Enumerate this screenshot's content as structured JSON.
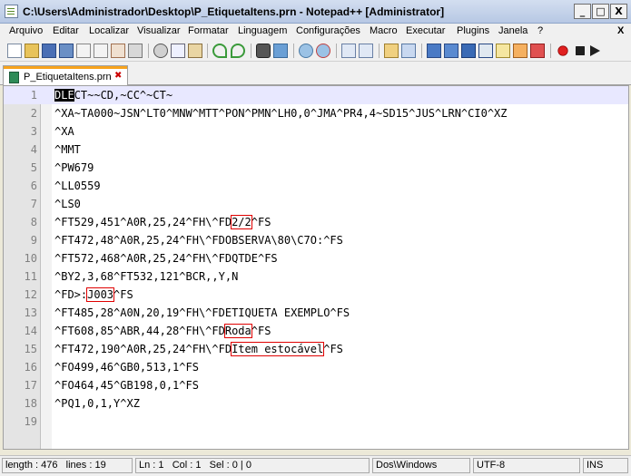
{
  "window": {
    "title": "C:\\Users\\Administrador\\Desktop\\P_EtiquetaItens.prn - Notepad++ [Administrator]",
    "minimize_label": "_",
    "maximize_label": "□",
    "close_label": "X"
  },
  "menu": {
    "items": [
      "Arquivo",
      "Editar",
      "Localizar",
      "Visualizar",
      "Formatar",
      "Linguagem",
      "Configurações",
      "Macro",
      "Executar",
      "Plugins",
      "Janela",
      "?"
    ],
    "close_label": "X"
  },
  "toolbar": {
    "icons": [
      "new-file-icon",
      "open-file-icon",
      "save-icon",
      "save-all-icon",
      "close-icon",
      "close-all-icon",
      "print-icon",
      "cut-icon",
      "copy-icon",
      "paste-icon",
      "undo-icon",
      "redo-icon",
      "find-icon",
      "replace-icon",
      "zoom-in-icon",
      "zoom-out-icon",
      "sync-v-icon",
      "sync-h-icon",
      "word-wrap-icon",
      "show-all-chars-icon",
      "indent-guide-icon",
      "doc-map-icon",
      "function-list-icon",
      "folder-workspace-icon",
      "monitor-icon",
      "record-macro-icon",
      "stop-macro-icon",
      "play-macro-icon"
    ]
  },
  "tab": {
    "label": "P_EtiquetaItens.prn",
    "close_label": "✖"
  },
  "editor": {
    "lines": [
      {
        "num": "1",
        "segments": [
          {
            "text": "DLE",
            "style": "dle"
          },
          {
            "text": "CT~~CD,~CC^~CT~"
          }
        ]
      },
      {
        "num": "2",
        "segments": [
          {
            "text": "^XA~TA000~JSN^LT0^MNW^MTT^PON^PMN^LH0,0^JMA^PR4,4~SD15^JUS^LRN^CI0^XZ"
          }
        ]
      },
      {
        "num": "3",
        "segments": [
          {
            "text": "^XA"
          }
        ]
      },
      {
        "num": "4",
        "segments": [
          {
            "text": "^MMT"
          }
        ]
      },
      {
        "num": "5",
        "segments": [
          {
            "text": "^PW679"
          }
        ]
      },
      {
        "num": "6",
        "segments": [
          {
            "text": "^LL0559"
          }
        ]
      },
      {
        "num": "7",
        "segments": [
          {
            "text": "^LS0"
          }
        ]
      },
      {
        "num": "8",
        "segments": [
          {
            "text": "^FT529,451^A0R,25,24^FH\\^FD"
          },
          {
            "text": "2/2",
            "style": "hl"
          },
          {
            "text": "^FS"
          }
        ]
      },
      {
        "num": "9",
        "segments": [
          {
            "text": "^FT472,48^A0R,25,24^FH\\^FDOBSERVA\\80\\C7O:^FS"
          }
        ]
      },
      {
        "num": "10",
        "segments": [
          {
            "text": "^FT572,468^A0R,25,24^FH\\^FDQTDE^FS"
          }
        ]
      },
      {
        "num": "11",
        "segments": [
          {
            "text": "^BY2,3,68^FT532,121^BCR,,Y,N"
          }
        ]
      },
      {
        "num": "12",
        "segments": [
          {
            "text": "^FD>:"
          },
          {
            "text": "J003",
            "style": "hl"
          },
          {
            "text": "^FS"
          }
        ]
      },
      {
        "num": "13",
        "segments": [
          {
            "text": "^FT485,28^A0N,20,19^FH\\^FDETIQUETA EXEMPLO^FS"
          }
        ]
      },
      {
        "num": "14",
        "segments": [
          {
            "text": "^FT608,85^ABR,44,28^FH\\^FD"
          },
          {
            "text": "Roda",
            "style": "hl"
          },
          {
            "text": "^FS"
          }
        ]
      },
      {
        "num": "15",
        "segments": [
          {
            "text": "^FT472,190^A0R,25,24^FH\\^FD"
          },
          {
            "text": "Item estocável",
            "style": "hl"
          },
          {
            "text": "^FS"
          }
        ]
      },
      {
        "num": "16",
        "segments": [
          {
            "text": "^FO499,46^GB0,513,1^FS"
          }
        ]
      },
      {
        "num": "17",
        "segments": [
          {
            "text": "^FO464,45^GB198,0,1^FS"
          }
        ]
      },
      {
        "num": "18",
        "segments": [
          {
            "text": "^PQ1,0,1,Y^XZ"
          }
        ]
      },
      {
        "num": "19",
        "segments": []
      }
    ]
  },
  "status": {
    "length": "length : 476",
    "lines": "lines : 19",
    "ln": "Ln : 1",
    "col": "Col : 1",
    "sel": "Sel : 0 | 0",
    "eol": "Dos\\Windows",
    "encoding": "UTF-8",
    "mode": "INS"
  }
}
